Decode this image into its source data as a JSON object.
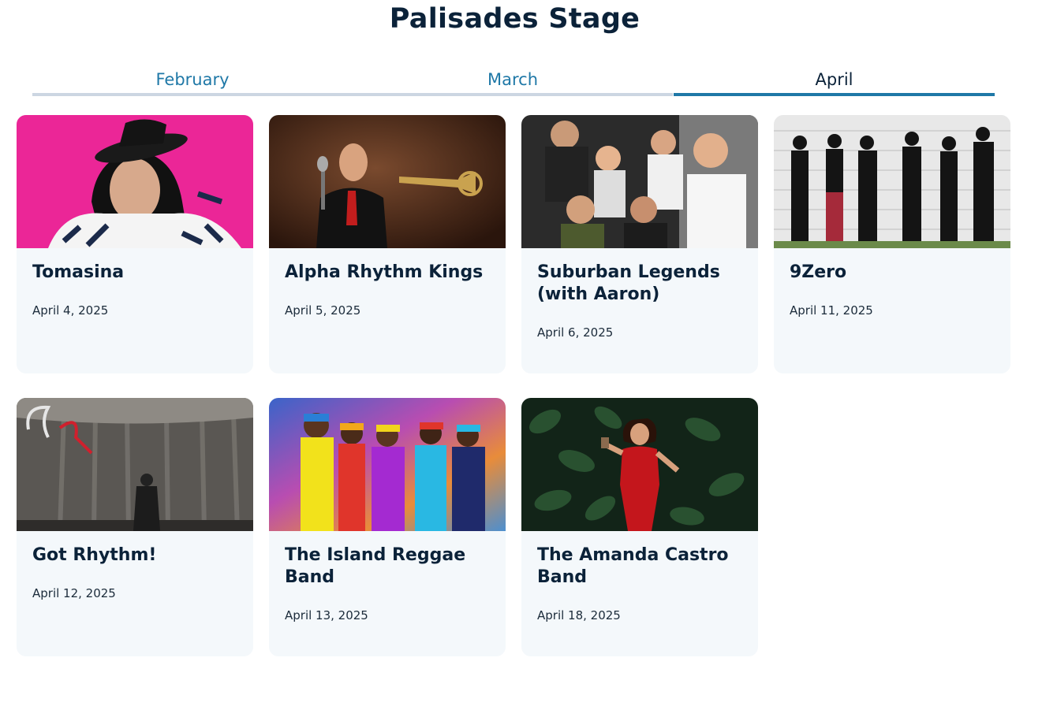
{
  "page": {
    "title": "Palisades Stage"
  },
  "tabs": [
    {
      "label": "February",
      "active": false
    },
    {
      "label": "March",
      "active": false
    },
    {
      "label": "April",
      "active": true
    }
  ],
  "events": [
    {
      "title": "Tomasina",
      "date": "April 4, 2025",
      "image": "photo-of-singer-in-black-hat"
    },
    {
      "title": "Alpha Rhythm Kings",
      "date": "April 5, 2025",
      "image": "photo-of-singer-with-trumpet"
    },
    {
      "title": "Suburban Legends (with Aaron)",
      "date": "April 6, 2025",
      "image": "photo-of-band-group"
    },
    {
      "title": "9Zero",
      "date": "April 11, 2025",
      "image": "photo-of-band-members-standing"
    },
    {
      "title": "Got Rhythm!",
      "date": "April 12, 2025",
      "image": "photo-of-performer-on-stage"
    },
    {
      "title": "The Island Reggae Band",
      "date": "April 13, 2025",
      "image": "photo-of-band-in-colorful-shirts"
    },
    {
      "title": "The Amanda Castro Band",
      "date": "April 18, 2025",
      "image": "photo-of-singer-in-red-dress"
    }
  ],
  "colors": {
    "heading": "#0b2239",
    "tab_text": "#1f78a7",
    "tab_active_underline": "#1f78a7",
    "tab_inactive_underline": "#ccd6e2",
    "card_background": "#f4f8fb"
  }
}
